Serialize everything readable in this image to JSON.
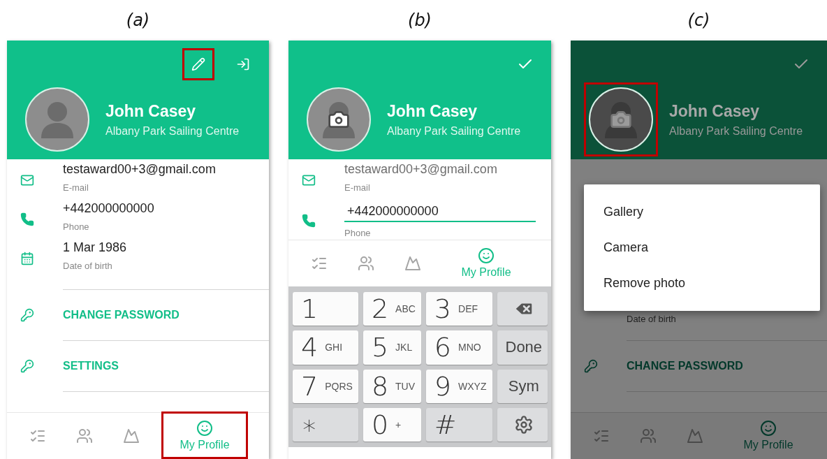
{
  "panels": [
    {
      "caption": "(a)",
      "dimmed": false,
      "header": {
        "name": "John Casey",
        "organization": "Albany Park Sailing Centre",
        "avatar_camera": false,
        "avatar_highlighted": false,
        "actions": [
          {
            "kind": "edit",
            "highlighted": true
          },
          {
            "kind": "logout",
            "highlighted": false
          }
        ]
      },
      "fields": [
        {
          "kind": "email",
          "editing": false,
          "greyed": false,
          "value": "testaward00+3@gmail.com",
          "label": "E-mail"
        },
        {
          "kind": "phone",
          "editing": false,
          "greyed": false,
          "value": "+442000000000",
          "label": "Phone"
        },
        {
          "kind": "date",
          "editing": false,
          "greyed": false,
          "value": "1 Mar 1986",
          "label": "Date of birth"
        }
      ],
      "links": [
        {
          "label": "CHANGE PASSWORD"
        },
        {
          "label": "SETTINGS"
        }
      ],
      "nav": [
        {
          "kind": "tasks",
          "selected": false
        },
        {
          "kind": "people",
          "selected": false
        },
        {
          "kind": "landscape",
          "selected": false
        },
        {
          "kind": "profile",
          "label": "My Profile",
          "selected": true,
          "highlighted": true
        }
      ]
    },
    {
      "caption": "(b)",
      "dimmed": false,
      "header": {
        "name": "John Casey",
        "organization": "Albany Park Sailing Centre",
        "avatar_camera": true,
        "avatar_highlighted": false,
        "actions": [
          {
            "kind": "done",
            "highlighted": false
          }
        ]
      },
      "fields": [
        {
          "kind": "email",
          "editing": false,
          "greyed": true,
          "value": "testaward00+3@gmail.com",
          "label": "E-mail"
        },
        {
          "kind": "phone",
          "editing": true,
          "greyed": false,
          "value": "+442000000000",
          "label": "Phone"
        }
      ],
      "nav": [
        {
          "kind": "tasks",
          "selected": false
        },
        {
          "kind": "people",
          "selected": false
        },
        {
          "kind": "landscape",
          "selected": false
        },
        {
          "kind": "profile",
          "label": "My Profile",
          "selected": true,
          "highlighted": false
        }
      ],
      "keyboard": [
        {
          "kind": "digit",
          "main": "1"
        },
        {
          "kind": "digit",
          "main": "2",
          "sub": "ABC"
        },
        {
          "kind": "digit",
          "main": "3",
          "sub": "DEF"
        },
        {
          "kind": "backspace"
        },
        {
          "kind": "digit",
          "main": "4",
          "sub": "GHI"
        },
        {
          "kind": "digit",
          "main": "5",
          "sub": "JKL"
        },
        {
          "kind": "digit",
          "main": "6",
          "sub": "MNO"
        },
        {
          "kind": "action",
          "main": "Done"
        },
        {
          "kind": "digit",
          "main": "7",
          "sub": "PQRS"
        },
        {
          "kind": "digit",
          "main": "8",
          "sub": "TUV"
        },
        {
          "kind": "digit",
          "main": "9",
          "sub": "WXYZ"
        },
        {
          "kind": "action",
          "main": "Sym"
        },
        {
          "kind": "symbol",
          "main": "∗"
        },
        {
          "kind": "digit",
          "main": "0",
          "sub": "+"
        },
        {
          "kind": "symbol",
          "main": "#"
        },
        {
          "kind": "settings"
        }
      ]
    },
    {
      "caption": "(c)",
      "dimmed": true,
      "header": {
        "name": "John Casey",
        "organization": "Albany Park Sailing Centre",
        "avatar_camera": true,
        "avatar_highlighted": true,
        "actions": [
          {
            "kind": "done",
            "highlighted": false
          }
        ]
      },
      "dialog": {
        "options": [
          "Gallery",
          "Camera",
          "Remove photo"
        ]
      },
      "fields": [
        {
          "label": "Date of birth"
        }
      ],
      "links": [
        {
          "label": "CHANGE PASSWORD"
        }
      ],
      "nav": [
        {
          "kind": "tasks",
          "selected": false
        },
        {
          "kind": "people",
          "selected": false
        },
        {
          "kind": "landscape",
          "selected": false
        },
        {
          "kind": "profile",
          "label": "My Profile",
          "selected": true,
          "highlighted": false
        }
      ]
    }
  ]
}
